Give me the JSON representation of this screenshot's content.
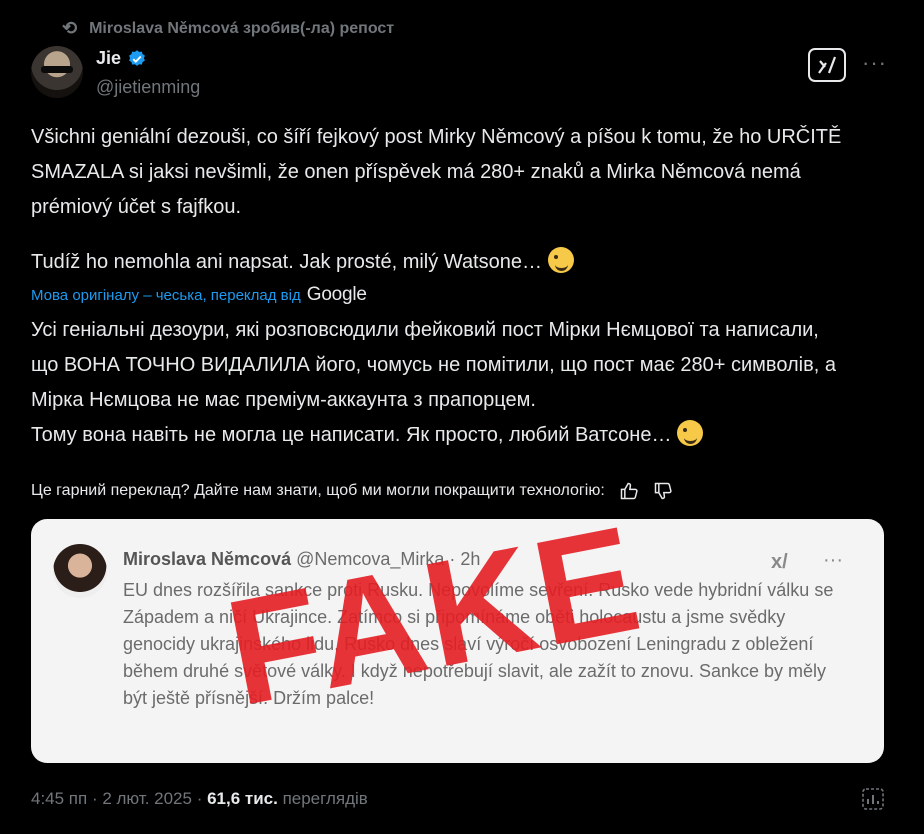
{
  "repost": {
    "text": "Miroslava Němcová зробив(-ла) репост",
    "icon": "repost-icon"
  },
  "author": {
    "name": "Jie",
    "handle": "@jietienming",
    "verified": true
  },
  "tweet": {
    "p1": "Všichni geniální dezouši, co šíří fejkový post Mirky Němcový a píšou k tomu, že ho URČITĚ SMAZALA si jaksi nevšimli, že onen příspěvek má 280+ znaků a Mirka Němcová nemá prémiový účet s fajfkou.",
    "p2": "Tudíž ho nemohla ani napsat. Jak prosté, milý Watsone…",
    "translation_note": "Мова оригіналу – чеська, переклад від",
    "translation_provider": "Google",
    "p3": "Усі геніальні дезоури, які розповсюдили фейковий пост Мірки Нємцової та написали, що ВОНА ТОЧНО ВИДАЛИЛА його, чомусь не помітили, що пост має 280+ символів, а Мірка Нємцова не має преміум-аккаунта з прапорцем.",
    "p4": "Тому вона навіть не могла це написати. Як просто, любий Ватсоне…",
    "feedback": "Це гарний переклад? Дайте нам знати, щоб ми могли покращити технологію:"
  },
  "embedded": {
    "name": "Miroslava Němcová",
    "handle_time": "@Nemcova_Mirka · 2h",
    "text": "EU dnes rozšířila sankce proti Rusku. Nepovolíme sevření. Rusko vede hybridní válku se Západem a ničí Ukrajince. Zatímco si připomínáme oběti holocaustu a jsme svědky genocidy ukrajinského lidu, Rusko dnes slaví výročí osvobození Leningradu z obležení během druhé světové války. I když nepotřebují slavit, ale zažít to znovu. Sankce by měly být ještě přísnější. Držím palce!",
    "stamp": "FAKE"
  },
  "meta": {
    "time": "4:45 пп · 2 лют. 2025 · ",
    "views": "61,6 тис.",
    "views_label": " переглядів"
  },
  "colors": {
    "accent": "#1d9bf0",
    "muted": "#71767b",
    "stamp": "#e41e23"
  }
}
